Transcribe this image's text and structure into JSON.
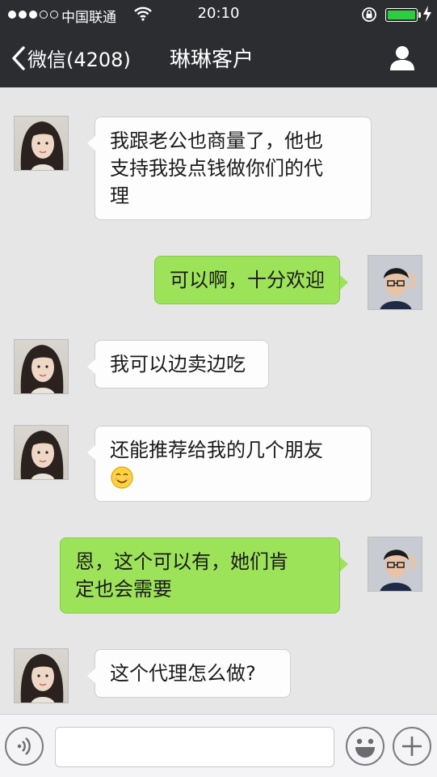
{
  "status_bar": {
    "carrier": "中国联通",
    "time": "20:10",
    "battery_level": 1.0
  },
  "nav": {
    "back_label": "微信(4208)",
    "title": "琳琳客户"
  },
  "messages": [
    {
      "sender": "contact",
      "lines": [
        "我跟老公也商量了，他也",
        "支持我投点钱做你们的代",
        "理"
      ]
    },
    {
      "sender": "me",
      "lines": [
        "可以啊，十分欢迎"
      ]
    },
    {
      "sender": "contact",
      "lines": [
        "我可以边卖边吃"
      ]
    },
    {
      "sender": "contact",
      "lines": [
        "还能推荐给我的几个朋友"
      ],
      "emoji": "smiling-face-emoji"
    },
    {
      "sender": "me",
      "lines": [
        "恩，这个可以有，她们肯",
        "定也会需要"
      ]
    },
    {
      "sender": "contact",
      "lines": [
        "这个代理怎么做?"
      ]
    }
  ],
  "input": {
    "value": "",
    "placeholder": ""
  },
  "colors": {
    "header_bg": "#2c2d31",
    "chat_bg": "#e6e6e6",
    "outgoing_bubble": "#9de35a",
    "incoming_bubble": "#fdfdfd",
    "battery": "#2ecc40"
  },
  "icons": [
    "signal-icon",
    "wifi-icon",
    "lock-rotation-icon",
    "battery-icon",
    "charging-icon",
    "back-chevron-icon",
    "contact-profile-icon",
    "voice-icon",
    "emoji-icon",
    "plus-icon"
  ]
}
